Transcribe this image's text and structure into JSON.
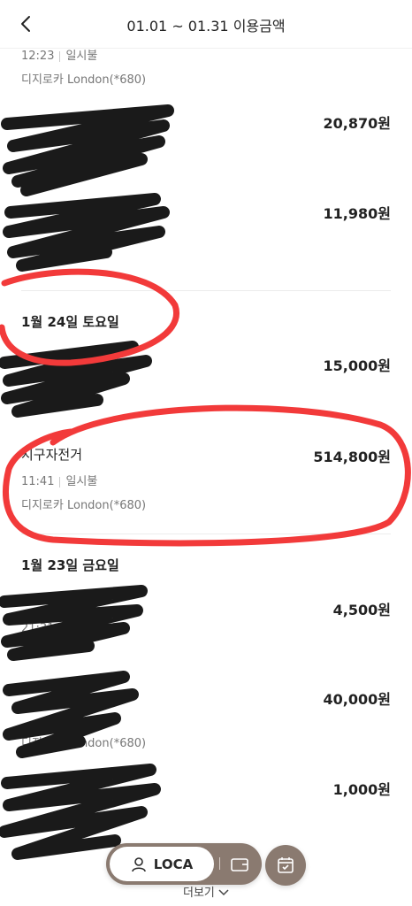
{
  "header": {
    "title": "01.01 ~ 01.31 이용금액"
  },
  "top_partial": {
    "time": "12:23",
    "pay_type": "일시불",
    "card": "디지로카 London(*680)"
  },
  "transactions_jan24_before": [
    {
      "name": "",
      "amount": "20,870원"
    },
    {
      "name": "",
      "amount": "11,980원"
    }
  ],
  "date_jan24": "1월 24일 토요일",
  "tx_jan24": [
    {
      "name": "",
      "amount": "15,000원"
    },
    {
      "name": "지구자전거",
      "amount": "514,800원",
      "time": "11:41",
      "pay_type": "일시불",
      "card": "디지로카 London(*680)"
    }
  ],
  "date_jan23": "1월 23일 금요일",
  "tx_jan23": [
    {
      "name": "",
      "amount": "4,500원",
      "time": "21:31"
    },
    {
      "name": "",
      "amount": "40,000원",
      "card": "디지로카 London(*680)"
    },
    {
      "name": "",
      "amount": "1,000원"
    }
  ],
  "bottom_bar": {
    "loca_label": "LOCA",
    "more_label": "더보기"
  },
  "colors": {
    "accent": "#8a7a70",
    "annotation_red": "#f23a3a",
    "scribble": "#1a1a1a"
  }
}
